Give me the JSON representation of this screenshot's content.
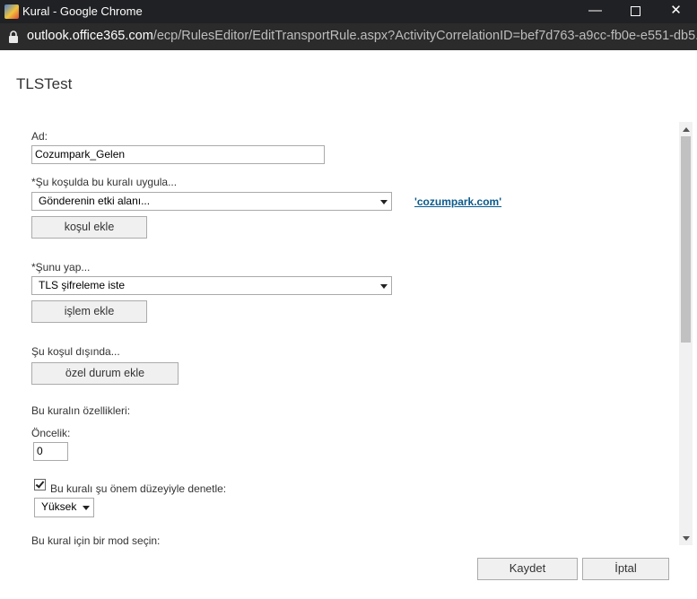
{
  "window": {
    "title": "Kural - Google Chrome",
    "minimize": "—",
    "close": "✕"
  },
  "urlbar": {
    "host": "outlook.office365.com",
    "path": "/ecp/RulesEditor/EditTransportRule.aspx?ActivityCorrelationID=bef7d763-a9cc-fb0e-e551-db5..."
  },
  "dialog": {
    "title": "TLSTest"
  },
  "form": {
    "name_label": "Ad:",
    "name_value": "Cozumpark_Gelen",
    "condition_label": "*Şu koşulda bu kuralı uygula...",
    "condition_select": "Gönderenin etki alanı...",
    "condition_link": "'cozumpark.com'",
    "add_condition_button": "koşul ekle",
    "action_label": "*Şunu yap...",
    "action_select": "TLS şifreleme iste",
    "add_action_button": "işlem ekle",
    "exception_label": "Şu koşul dışında...",
    "add_exception_button": "özel durum ekle",
    "properties_label": "Bu kuralın özellikleri:",
    "priority_label": "Öncelik:",
    "priority_value": "0",
    "audit_checkbox_label": "Bu kuralı şu önem düzeyiyle denetle:",
    "audit_checked": true,
    "severity_select": "Yüksek",
    "mode_label": "Bu kural için bir mod seçin:"
  },
  "footer": {
    "save_button": "Kaydet",
    "cancel_button": "İptal"
  }
}
